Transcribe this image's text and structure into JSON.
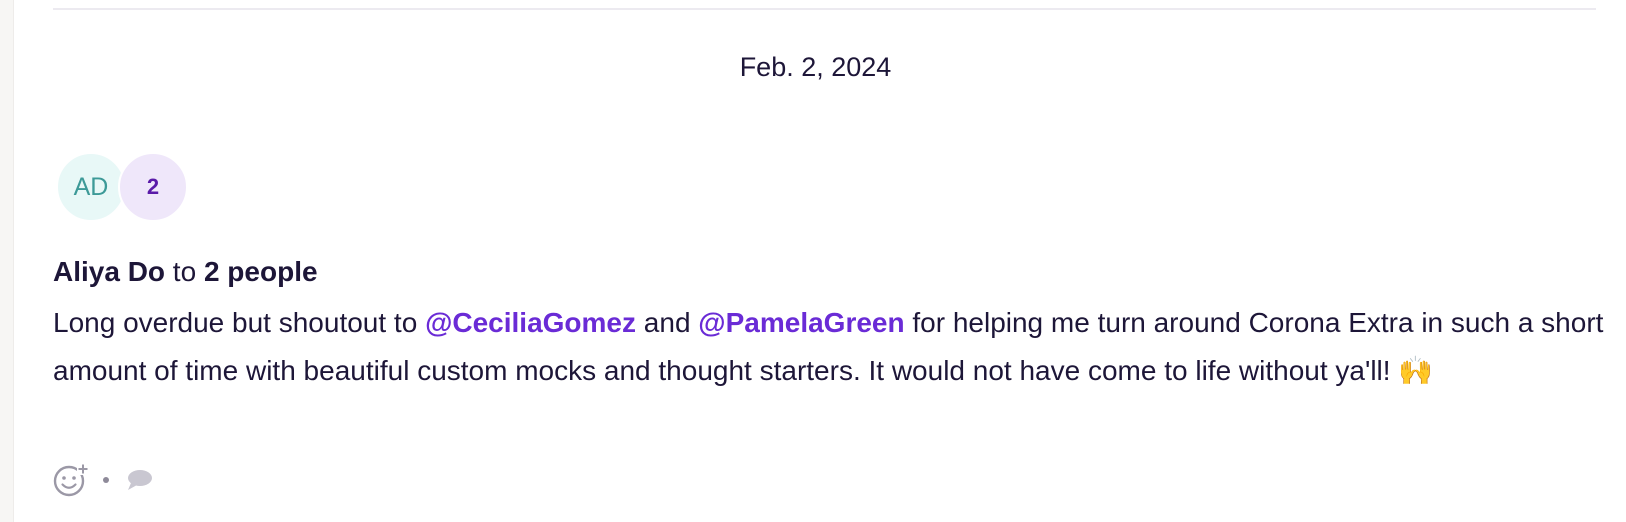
{
  "post": {
    "date": "Feb. 2, 2024",
    "avatars": {
      "author_initials": "AD",
      "recipient_count": "2"
    },
    "author": "Aliya Do",
    "connector": " to ",
    "recipients": "2 people",
    "message": {
      "part1": "Long overdue but shoutout to ",
      "mention1": "@CeciliaGomez",
      "part2": " and ",
      "mention2": "@PamelaGreen",
      "part3": " for helping me turn around Corona Extra in such a short amount of time with beautiful custom mocks and thought starters. It would not have come to life without ya'll! ",
      "emoji": "🙌"
    },
    "actions": {
      "add_reaction_icon": "add-reaction-icon",
      "comment_icon": "comment-icon"
    }
  },
  "colors": {
    "mention": "#6a2bd6",
    "text": "#1d1638",
    "avatar_initials_bg": "#e8f8f7",
    "avatar_count_bg": "#efe7fa"
  }
}
